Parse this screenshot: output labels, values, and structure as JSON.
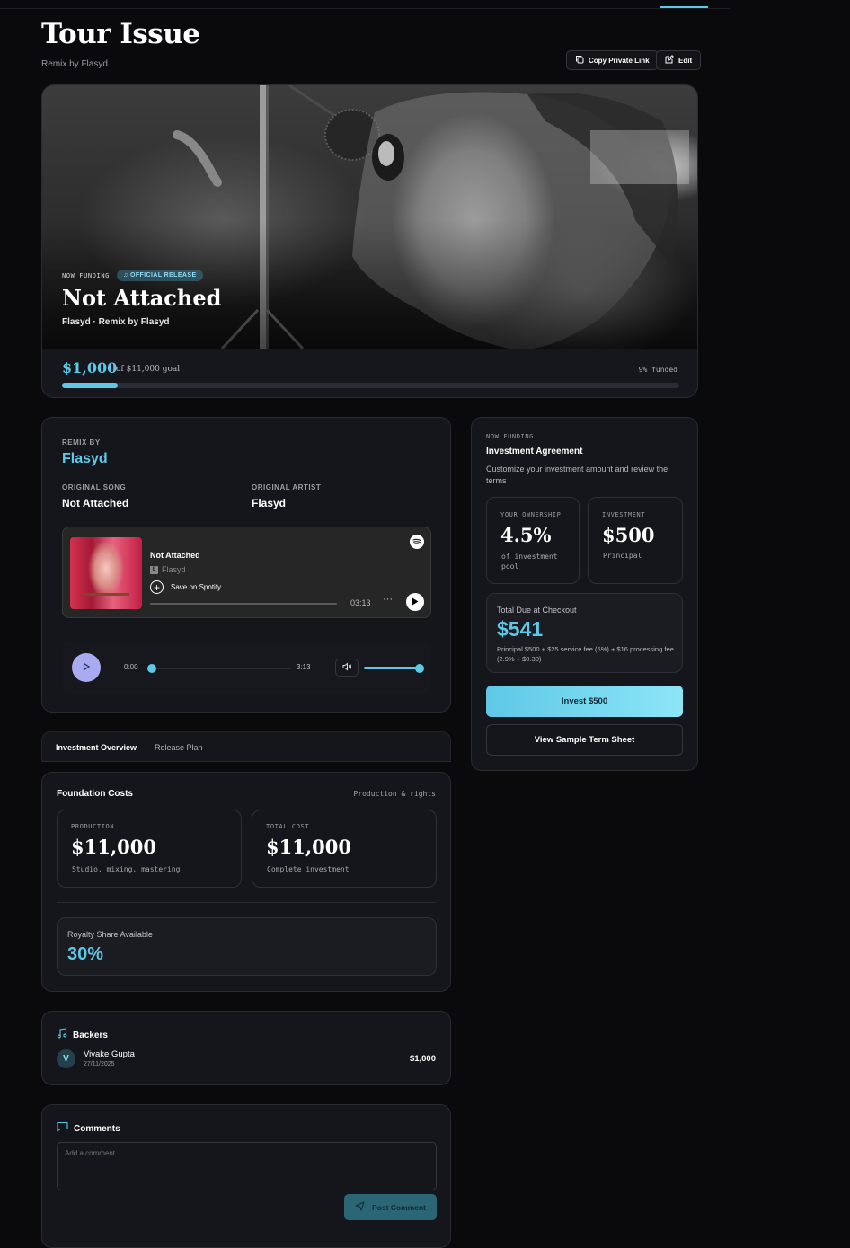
{
  "page": {
    "title": "Tour Issue",
    "subtitle": "Remix by Flasyd"
  },
  "actions": {
    "copy_link": "Copy Private Link",
    "edit": "Edit"
  },
  "hero": {
    "now_funding": "NOW FUNDING",
    "badge": "OFFICIAL RELEASE",
    "title": "Not Attached",
    "byline": "Flasyd · Remix by Flasyd",
    "raised": "$1,000",
    "goal": "of $11,000 goal",
    "funded_text": "9% funded",
    "progress_fraction": 0.09
  },
  "remix": {
    "remix_by_label": "REMIX BY",
    "remix_by": "Flasyd",
    "original_song_label": "ORIGINAL SONG",
    "original_song": "Not Attached",
    "original_artist_label": "ORIGINAL ARTIST",
    "original_artist": "Flasyd"
  },
  "spotify": {
    "track": "Not Attached",
    "explicit": "E",
    "artist": "Flasyd",
    "save": "Save on Spotify",
    "duration": "03:13",
    "more": "···"
  },
  "audio": {
    "current": "0:00",
    "total": "3:13",
    "progress_fraction": 0.0,
    "volume_fraction": 1.0
  },
  "tabs": [
    {
      "label": "Investment Overview",
      "active": true
    },
    {
      "label": "Release Plan",
      "active": false
    }
  ],
  "foundation": {
    "title": "Foundation Costs",
    "tag": "Production & rights",
    "production_label": "PRODUCTION",
    "production_value": "$11,000",
    "production_desc": "Studio, mixing, mastering",
    "total_label": "TOTAL COST",
    "total_value": "$11,000",
    "total_desc": "Complete investment",
    "royalty_label": "Royalty Share Available",
    "royalty_value": "30%"
  },
  "backers": {
    "title": "Backers",
    "items": [
      {
        "initial": "V",
        "name": "Vivake Gupta",
        "date": "27/11/2025",
        "amount": "$1,000"
      }
    ]
  },
  "comments": {
    "title": "Comments",
    "placeholder": "Add a comment...",
    "post": "Post Comment"
  },
  "investment": {
    "now_funding": "NOW FUNDING",
    "title": "Investment Agreement",
    "desc": "Customize your investment amount and review the terms",
    "ownership_label": "YOUR OWNERSHIP",
    "ownership_value": "4.5%",
    "ownership_desc": "of investment pool",
    "investment_label": "INVESTMENT",
    "investment_value": "$500",
    "investment_desc": "Principal",
    "due_label": "Total Due at Checkout",
    "due_value": "$541",
    "due_breakdown": "Principal $500 + $25 service fee (5%) + $16 processing fee (2.9% + $0.30)",
    "invest_button": "Invest $500",
    "term_sheet_button": "View Sample Term Sheet"
  },
  "colors": {
    "accent": "#5ec8e6",
    "background": "#0a0a0c",
    "card": "#15161b",
    "play_button": "#a9abf0"
  }
}
